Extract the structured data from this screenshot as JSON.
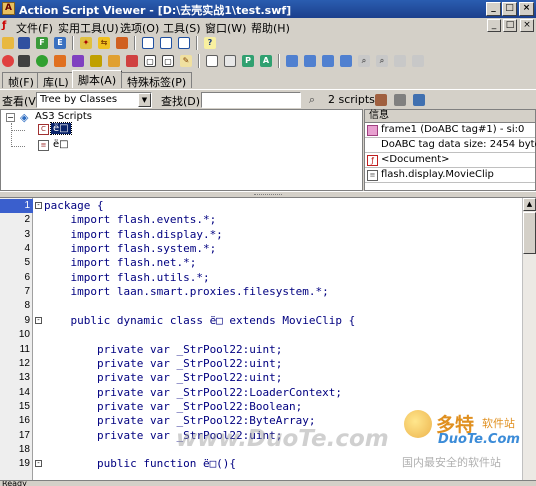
{
  "window": {
    "title": "Action Script Viewer - [D:\\去壳实战1\\test.swf]",
    "minimize": "_",
    "restore": "□",
    "close": "×"
  },
  "menu": {
    "items": [
      "文件(F)",
      "实用工具(U)",
      "选项(O)",
      "工具(S)",
      "窗口(W)",
      "帮助(H)"
    ],
    "mdi_controls": [
      "_",
      "□",
      "×"
    ]
  },
  "tabs": [
    "帧(F)",
    "库(L)",
    "脚本(A)",
    "特殊标签(P)"
  ],
  "active_tab": "脚本(A)",
  "filter": {
    "view_label": "查看(V)",
    "view_value": "Tree by Classes",
    "find_label": "查找(D):",
    "find_value": "",
    "count": "2 scripts."
  },
  "tree": {
    "root": "AS3 Scripts",
    "children": [
      "ë□",
      "ë□"
    ]
  },
  "info": {
    "header": "信息",
    "rows": [
      "frame1 (DoABC tag#1) - si:0",
      "DoABC tag data size: 2454 bytes",
      "<Document>",
      "flash.display.MovieClip"
    ]
  },
  "editor": {
    "lines": [
      {
        "n": "1",
        "code": "package {",
        "fold": "-",
        "active": true
      },
      {
        "n": "2",
        "code": "    import flash.events.*;"
      },
      {
        "n": "3",
        "code": "    import flash.display.*;"
      },
      {
        "n": "4",
        "code": "    import flash.system.*;"
      },
      {
        "n": "5",
        "code": "    import flash.net.*;"
      },
      {
        "n": "6",
        "code": "    import flash.utils.*;"
      },
      {
        "n": "7",
        "code": "    import laan.smart.proxies.filesystem.*;"
      },
      {
        "n": "8",
        "code": ""
      },
      {
        "n": "9",
        "code": "    public dynamic class ë□ extends MovieClip {",
        "fold": "-"
      },
      {
        "n": "10",
        "code": ""
      },
      {
        "n": "11",
        "code": "        private var _StrPool22:uint;"
      },
      {
        "n": "12",
        "code": "        private var _StrPool22:uint;"
      },
      {
        "n": "13",
        "code": "        private var _StrPool22:uint;"
      },
      {
        "n": "14",
        "code": "        private var _StrPool22:LoaderContext;"
      },
      {
        "n": "15",
        "code": "        private var _StrPool22:Boolean;"
      },
      {
        "n": "16",
        "code": "        private var _StrPool22:ByteArray;"
      },
      {
        "n": "17",
        "code": "        private var _StrPool22:uint;"
      },
      {
        "n": "18",
        "code": ""
      },
      {
        "n": "19",
        "code": "        public function ë□(){",
        "fold": "-"
      }
    ]
  },
  "status": "Ready",
  "watermarks": {
    "center": "www.DuoTe.com",
    "logo_cn": "多特",
    "logo_cn2": "软件站",
    "logo_en": "DuoTe.Com",
    "logo_tag": "国内最安全的软件站"
  },
  "colors": {
    "titlebar": "#1c3f8c",
    "code_text": "#000080",
    "active_line_number": "#3a5fcd"
  }
}
